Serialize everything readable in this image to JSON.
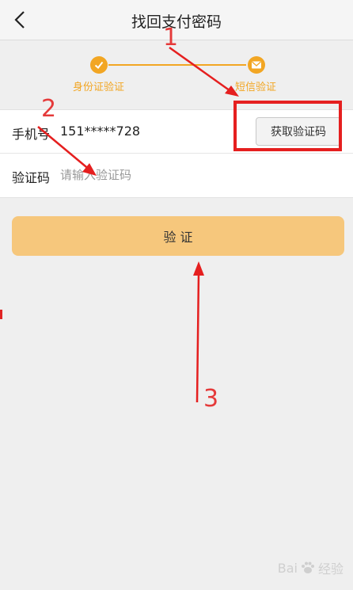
{
  "header": {
    "title": "找回支付密码"
  },
  "steps": [
    {
      "label": "身份证验证",
      "icon": "check-icon",
      "status": "done"
    },
    {
      "label": "短信验证",
      "icon": "envelope-icon",
      "status": "current"
    }
  ],
  "form": {
    "phone_label": "手机号",
    "phone_value": "151*****728",
    "get_code_label": "获取验证码",
    "code_label": "验证码",
    "code_placeholder": "请输入验证码",
    "code_value": ""
  },
  "verify_label": "验 证",
  "annotations": [
    "1",
    "2",
    "3"
  ],
  "watermark": {
    "brand_left": "Bai",
    "brand_right": "经验"
  },
  "colors": {
    "accent": "#f2a623",
    "button": "#f6c77c",
    "annotation_red": "#e51f1f"
  }
}
